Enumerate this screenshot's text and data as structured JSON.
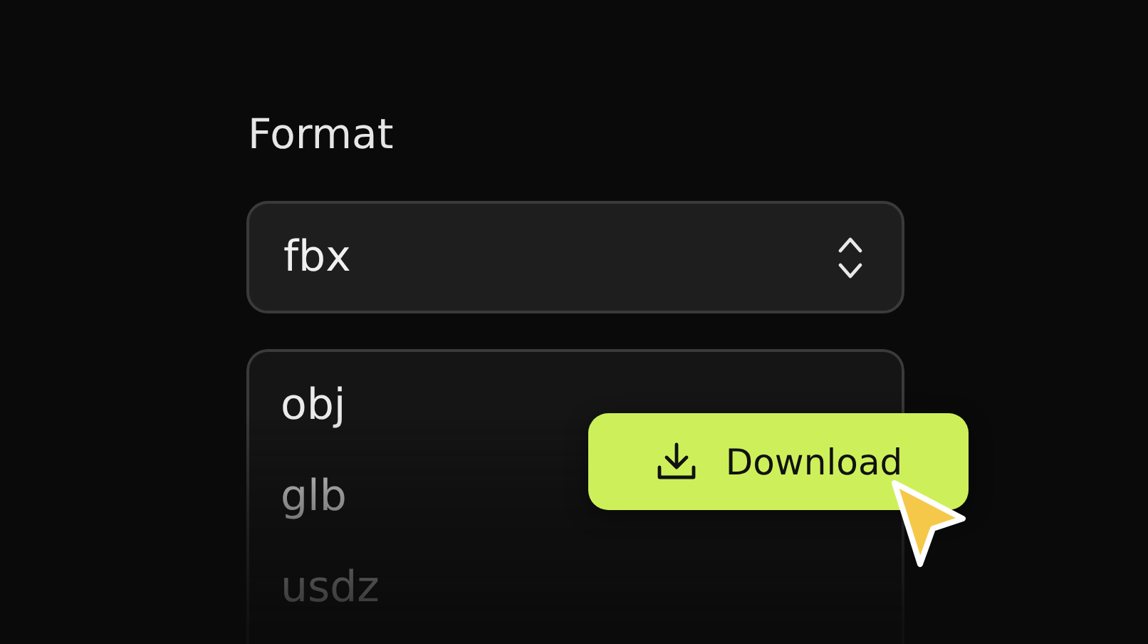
{
  "format": {
    "label": "Format",
    "value": "fbx"
  },
  "options": [
    {
      "label": "obj"
    },
    {
      "label": "glb"
    },
    {
      "label": "usdz"
    }
  ],
  "download_button": {
    "label": "Download"
  }
}
